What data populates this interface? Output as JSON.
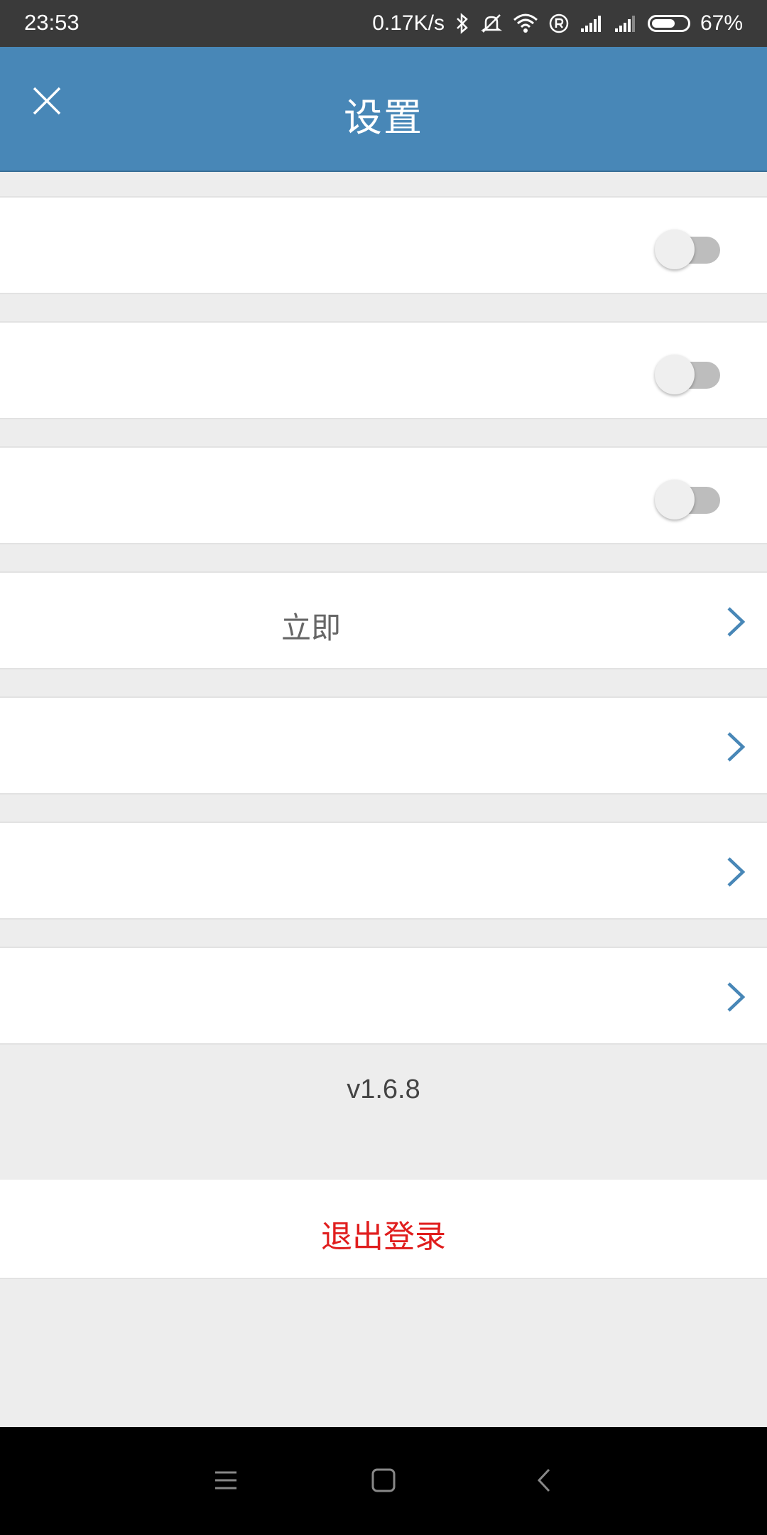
{
  "status_bar": {
    "time": "23:53",
    "net_speed": "0.17K/s",
    "battery": "67%",
    "battery_level": 0.67,
    "icons": [
      "bluetooth-icon",
      "mute-icon",
      "wifi-icon",
      "roaming-r-icon",
      "signal-icon",
      "signal-icon",
      "battery-icon"
    ]
  },
  "header": {
    "title": "设置",
    "close_icon": "close-icon"
  },
  "settings": {
    "toggles": [
      {
        "label": "",
        "on": false
      },
      {
        "label": "",
        "on": false
      },
      {
        "label": "",
        "on": false
      }
    ],
    "links": [
      {
        "label": "立即"
      },
      {
        "label": ""
      },
      {
        "label": ""
      },
      {
        "label": ""
      }
    ]
  },
  "version": "v1.6.8",
  "logout_label": "退出登录",
  "colors": {
    "header_bg": "#4887b7",
    "accent": "#4887b7",
    "logout": "#e01d1d",
    "page_bg": "#ededed"
  },
  "nav_bar": {
    "icons": [
      "menu-icon",
      "home-icon",
      "back-icon"
    ]
  }
}
